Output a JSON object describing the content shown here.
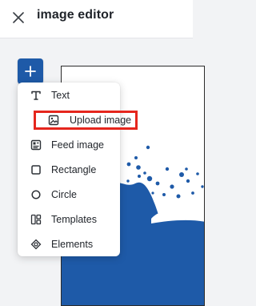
{
  "header": {
    "title": "image editor",
    "close_icon": "close-icon"
  },
  "toolbar": {
    "add_icon": "plus-icon",
    "accent_color": "#1e5aa8"
  },
  "menu": {
    "items": [
      {
        "label": "Text",
        "icon": "text-icon"
      },
      {
        "label": "Upload image",
        "icon": "upload-image-icon",
        "highlighted": true
      },
      {
        "label": "Feed image",
        "icon": "feed-image-icon"
      },
      {
        "label": "Rectangle",
        "icon": "rectangle-icon"
      },
      {
        "label": "Circle",
        "icon": "circle-icon"
      },
      {
        "label": "Templates",
        "icon": "templates-icon"
      },
      {
        "label": "Elements",
        "icon": "elements-icon"
      }
    ],
    "highlight_color": "#e5261d"
  },
  "canvas": {
    "wave_color": "#1e5aa8"
  }
}
